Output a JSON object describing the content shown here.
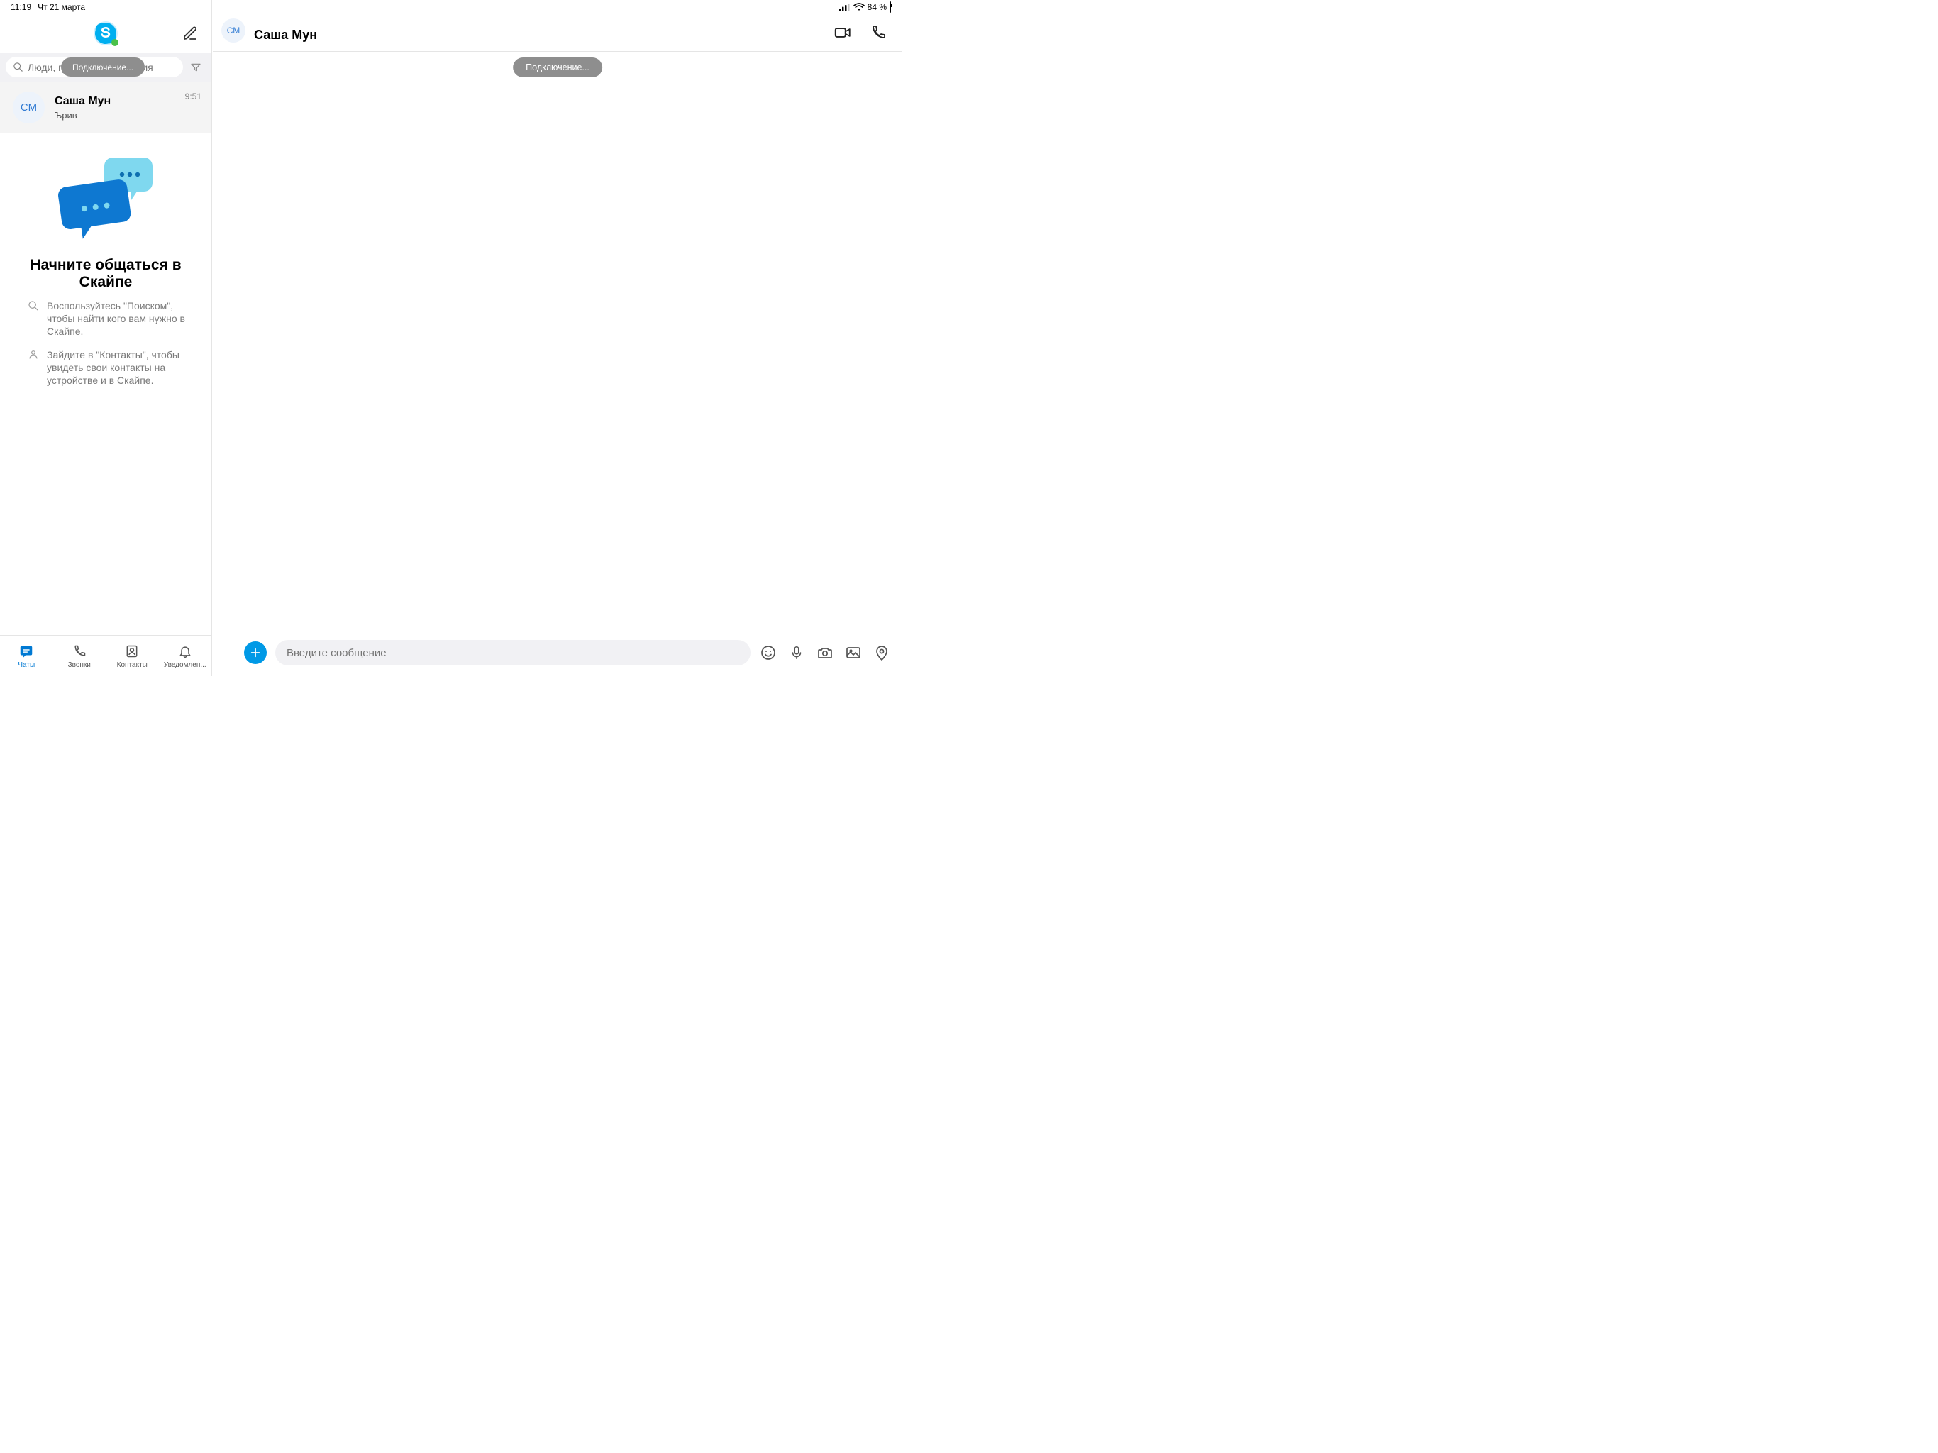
{
  "statusbar": {
    "time": "11:19",
    "date": "Чт 21 марта",
    "battery_pct": "84 %"
  },
  "sidebar": {
    "search_placeholder": "Люди, группы и сообщения",
    "connecting_label": "Подключение...",
    "chat": {
      "avatar_initials": "СМ",
      "name": "Саша Мун",
      "snippet": "Ърив",
      "time": "9:51"
    },
    "onboarding": {
      "title": "Начните общаться в Скайпе",
      "tip1": "Воспользуйтесь \"Поиском\", чтобы найти кого вам нужно в Скайпе.",
      "tip2": "Зайдите в \"Контакты\", чтобы увидеть свои контакты на устройстве и в Скайпе."
    },
    "tabs": {
      "chats": "Чаты",
      "calls": "Звонки",
      "contacts": "Контакты",
      "notifications": "Уведомлен..."
    }
  },
  "main": {
    "avatar_initials": "СМ",
    "title": "Саша Мун",
    "connecting_label": "Подключение...",
    "compose_placeholder": "Введите сообщение"
  }
}
